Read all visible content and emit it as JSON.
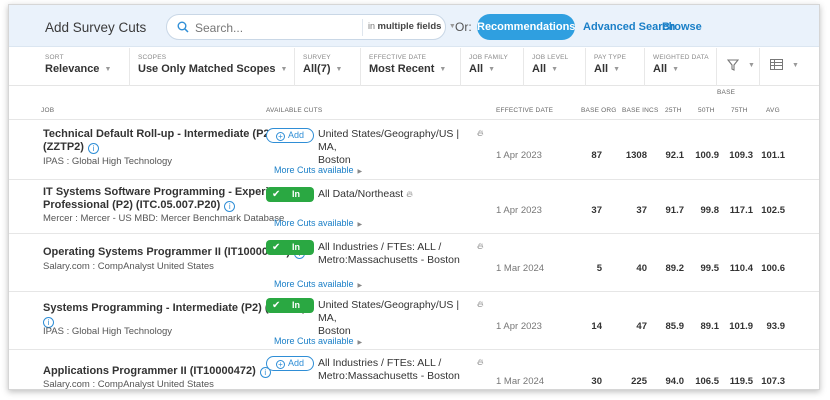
{
  "header": {
    "title": "Add Survey Cuts",
    "search_placeholder": "Search...",
    "in_prefix": "in",
    "in_value": "multiple fields",
    "or_label": "Or:",
    "recommendations": "Recommendations",
    "advanced_search": "Advanced Search",
    "browse": "Browse"
  },
  "filters": [
    {
      "label": "SORT",
      "value": "Relevance"
    },
    {
      "label": "SCOPES",
      "value": "Use Only Matched Scopes"
    },
    {
      "label": "SURVEY",
      "value": "All(7)"
    },
    {
      "label": "EFFECTIVE DATE",
      "value": "Most Recent"
    },
    {
      "label": "JOB FAMILY",
      "value": "All"
    },
    {
      "label": "JOB LEVEL",
      "value": "All"
    },
    {
      "label": "PAY TYPE",
      "value": "All"
    },
    {
      "label": "WEIGHTED DATA",
      "value": "All"
    }
  ],
  "columns": {
    "job": "JOB",
    "cuts": "AVAILABLE CUTS",
    "effective_date": "EFFECTIVE DATE",
    "base_org": "BASE ORG",
    "base_incs": "BASE INCS",
    "base_group": "BASE",
    "p25": "25TH",
    "p50": "50TH",
    "p75": "75TH",
    "avg": "AVG"
  },
  "rows": [
    {
      "title_line1": "Technical Default Roll-up - Intermediate (P2)",
      "title_line2": "(ZZTP2)",
      "source": "IPAS : Global High Technology",
      "button": "Add",
      "cut_line1": "United States/Geography/US | MA,",
      "cut_line2": "Boston",
      "more": "More Cuts available",
      "date": "1 Apr 2023",
      "base_org": "87",
      "base_incs": "1308",
      "p25": "92.1",
      "p50": "100.9",
      "p75": "109.3",
      "avg": "101.1"
    },
    {
      "title_line1": "IT Systems Software Programming - Experienced",
      "title_line2": "Professional (P2) (ITC.05.007.P20)",
      "source": "Mercer : Mercer - US MBD: Mercer Benchmark Database",
      "button": "In",
      "cut_line1": "All Data/Northeast",
      "cut_line2": "",
      "more": "More Cuts available",
      "date": "1 Apr 2023",
      "base_org": "37",
      "base_incs": "37",
      "p25": "91.7",
      "p50": "99.8",
      "p75": "117.1",
      "avg": "102.5"
    },
    {
      "title_line1": "Operating Systems Programmer II (IT10000072)",
      "title_line2": "",
      "source": "Salary.com : CompAnalyst United States",
      "button": "In",
      "cut_line1": "All Industries / FTEs: ALL /",
      "cut_line2": "Metro:Massachusetts - Boston",
      "more": "More Cuts available",
      "date": "1 Mar 2024",
      "base_org": "5",
      "base_incs": "40",
      "p25": "89.2",
      "p50": "99.5",
      "p75": "110.4",
      "avg": "100.6"
    },
    {
      "title_line1": "Systems Programming - Intermediate (P2) (IMRP2)",
      "title_line2": "",
      "source": "IPAS : Global High Technology",
      "button": "In",
      "cut_line1": "United States/Geography/US | MA,",
      "cut_line2": "Boston",
      "more": "More Cuts available",
      "date": "1 Apr 2023",
      "base_org": "14",
      "base_incs": "47",
      "p25": "85.9",
      "p50": "89.1",
      "p75": "101.9",
      "avg": "93.9"
    },
    {
      "title_line1": "Applications Programmer II (IT10000472)",
      "title_line2": "",
      "source": "Salary.com : CompAnalyst United States",
      "button": "Add",
      "cut_line1": "All Industries / FTEs: ALL /",
      "cut_line2": "Metro:Massachusetts - Boston",
      "more": "",
      "date": "1 Mar 2024",
      "base_org": "30",
      "base_incs": "225",
      "p25": "94.0",
      "p50": "106.5",
      "p75": "119.5",
      "avg": "107.3"
    }
  ],
  "icons": {
    "search": "search-icon",
    "filter": "funnel-icon",
    "columns": "columns-icon",
    "info": "info-icon",
    "flame": "flame-icon",
    "check": "check-icon",
    "plus": "plus-icon"
  },
  "colors": {
    "accent": "#2f9fe0",
    "link": "#1a7fc7",
    "in_green": "#2aa842",
    "header_bg": "#eaf2fb"
  }
}
